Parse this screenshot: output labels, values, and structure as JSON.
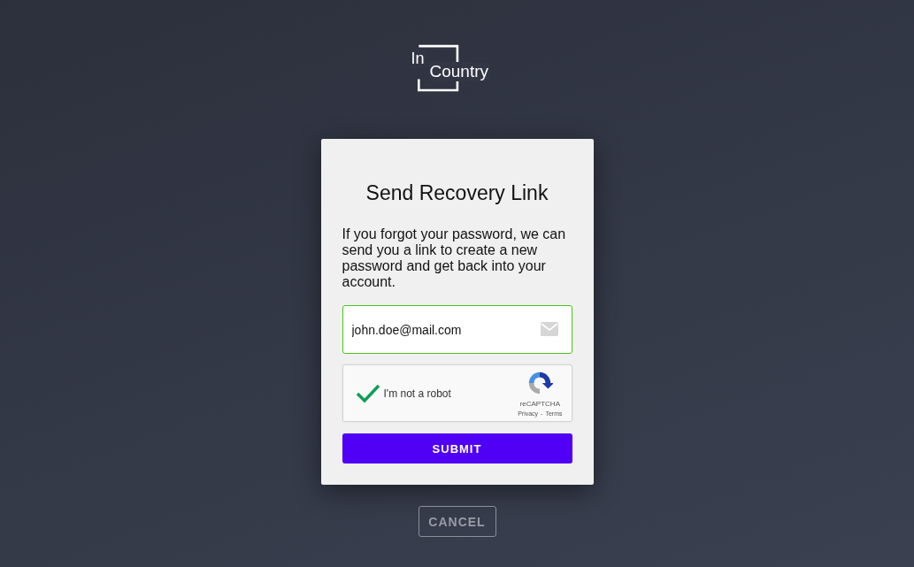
{
  "logo": {
    "prefix": "In",
    "name": "Country"
  },
  "card": {
    "title": "Send Recovery Link",
    "description": "If you forgot your password, we can send you a link to create a new password and get back into your account.",
    "email_field": {
      "value": "john.doe@mail.com",
      "valid": true
    },
    "captcha": {
      "label": "I'm not a robot",
      "checked": true,
      "brand": "reCAPTCHA",
      "privacy": "Privacy",
      "separator": "-",
      "terms": "Terms"
    },
    "submit_button": "SUBMIT"
  },
  "cancel_button": "CANCEL"
}
